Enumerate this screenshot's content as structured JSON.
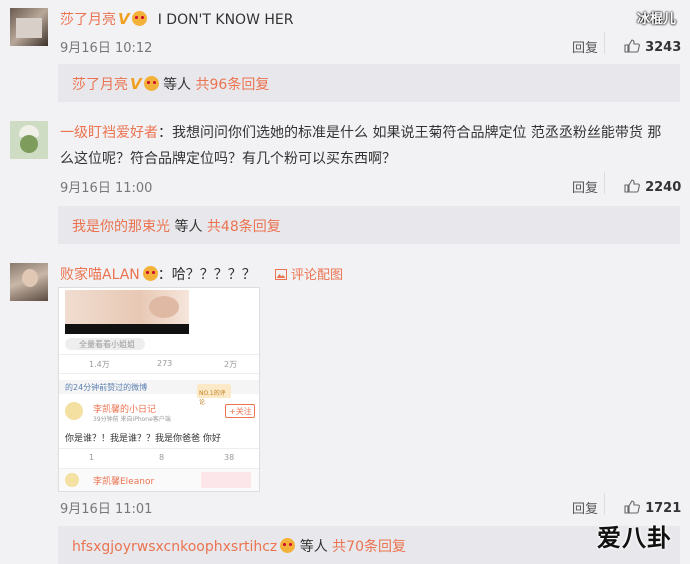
{
  "watermark_top": "冰棍儿",
  "watermark_bottom": "爱八卦",
  "comments": [
    {
      "username": "莎了月亮",
      "verified_mark": "V",
      "text": "I DON'T KNOW HER",
      "time": "9月16日 10:12",
      "reply_label": "回复",
      "likes": "3243",
      "sub": {
        "user": "莎了月亮",
        "verified_mark": "V",
        "mid": "等人",
        "count": "共96条回复"
      }
    },
    {
      "username": "一级盯裆爱好者",
      "text_line1": "我想问问你们选她的标准是什么 如果说王菊符合品牌定位 范丞丞粉丝能带货 那",
      "text_line2": "么这位呢？符合品牌定位吗？有几个粉可以买东西啊？",
      "time": "9月16日 11:00",
      "reply_label": "回复",
      "likes": "2240",
      "sub": {
        "user": "我是你的那束光",
        "mid": "等人",
        "count": "共48条回复"
      }
    },
    {
      "username": "败家喵ALAN",
      "text": "哈？？？？？",
      "image_link": "评论配图",
      "time": "9月16日 11:01",
      "reply_label": "回复",
      "likes": "1721",
      "sub": {
        "user": "hfsxgjoyrwsxcnkoophxsrtihcz",
        "mid": "等人",
        "count": "共70条回复"
      }
    }
  ],
  "embedded_card": {
    "label_source": "全量看看小姐姐",
    "stat_repost": "1.4万",
    "stat_comment": "273",
    "stat_like": "2万",
    "section_title": "的24分钟前赞过的微博",
    "badge_text": "NO.1的评论",
    "inner_user": "李凯馨的小日记",
    "inner_sub": "39分钟前 来自iPhone客户端",
    "follow_label": "+关注",
    "inner_text": "你是谁？！我是谁？？我是你爸爸 你好",
    "inner_repost": "1",
    "inner_comment": "8",
    "inner_like": "38",
    "footer_user": "李凯馨Eleanor"
  }
}
